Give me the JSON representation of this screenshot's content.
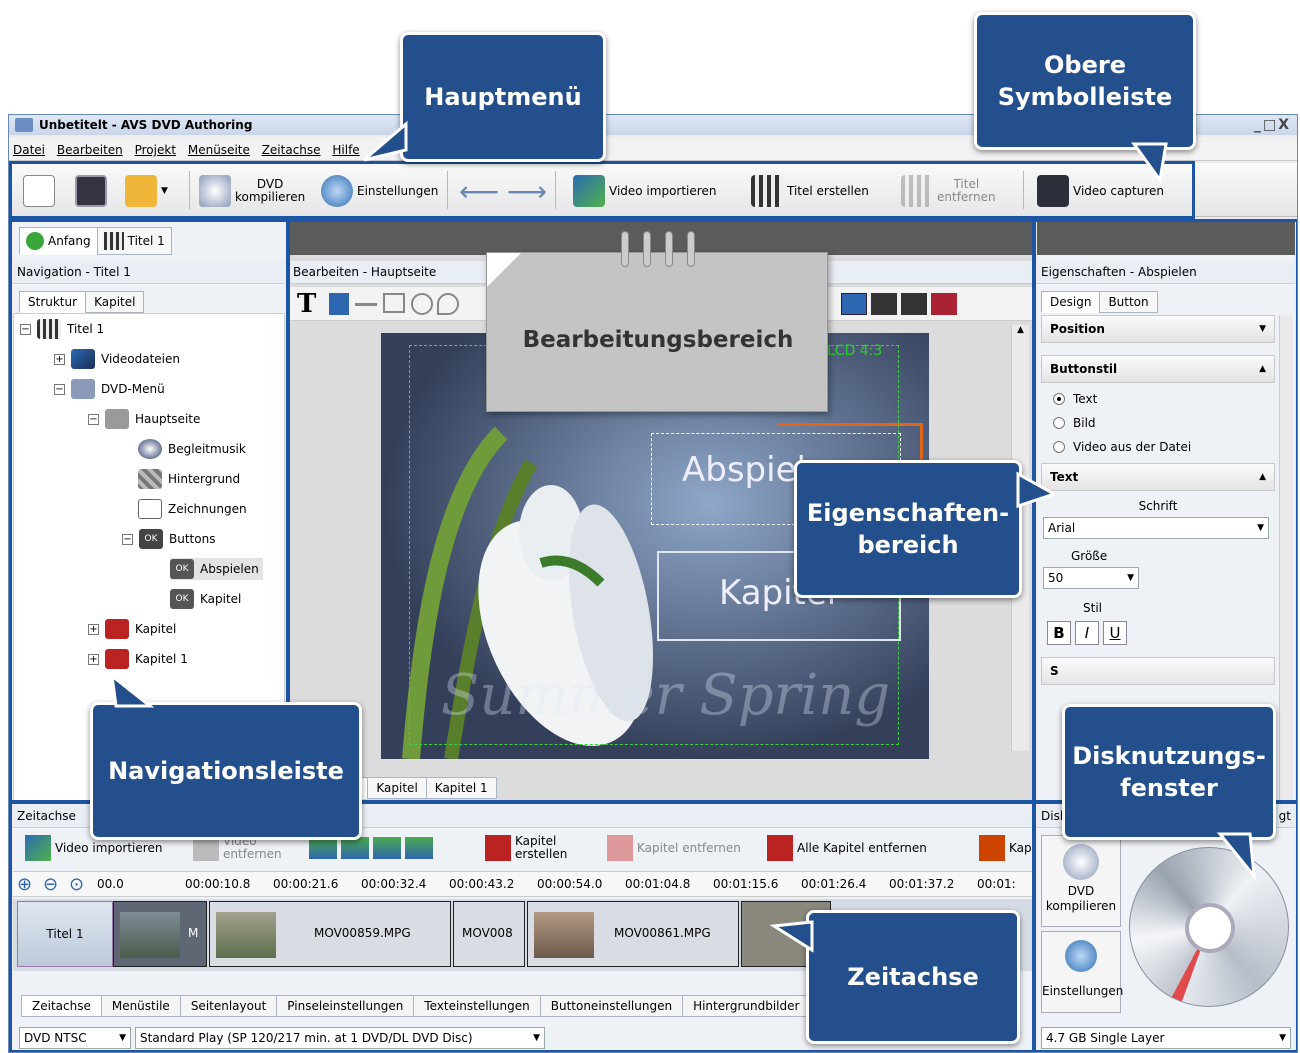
{
  "window": {
    "title": "Unbetitelt - AVS DVD Authoring",
    "controls": "_□X"
  },
  "menu": [
    "Datei",
    "Bearbeiten",
    "Projekt",
    "Menüseite",
    "Zeitachse",
    "Hilfe"
  ],
  "toolbar": {
    "dvd_compile": "DVD\nkompilieren",
    "settings": "Einstellungen",
    "import_video": "Video importieren",
    "create_title": "Titel erstellen",
    "remove_title": "Titel\nentfernen",
    "capture_video": "Video capturen"
  },
  "left": {
    "tabs": [
      "Anfang",
      "Titel 1"
    ],
    "header": "Navigation - Titel 1",
    "subtabs": [
      "Struktur",
      "Kapitel"
    ],
    "tree": [
      "Titel 1",
      "Videodateien",
      "DVD-Menü",
      "Hauptseite",
      "Begleitmusik",
      "Hintergrund",
      "Zeichnungen",
      "Buttons",
      "Abspielen",
      "Kapitel",
      "Kapitel",
      "Kapitel 1"
    ]
  },
  "editor": {
    "header": "Bearbeiten - Hauptseite",
    "lcd": "LCD 4:3",
    "btn_play": "Abspielen",
    "btn_chapter": "Kapitel",
    "bottom_tabs": [
      "e",
      "Kapitel",
      "Kapitel 1"
    ],
    "watermark": "Summer Spring"
  },
  "props": {
    "header": "Eigenschaften - Abspielen",
    "tabs": [
      "Design",
      "Button"
    ],
    "position": "Position",
    "buttonstil": "Buttonstil",
    "radios": [
      "Text",
      "Bild",
      "Video aus der Datei"
    ],
    "text": "Text",
    "schrift": "Schrift",
    "font": "Arial",
    "groesse": "Größe",
    "size": "50",
    "stil": "Stil",
    "b": "B",
    "i": "I",
    "u": "U",
    "s": "S"
  },
  "timeline": {
    "header": "Zeitachse",
    "import": "Video importieren",
    "remove_video": "Video\nentfernen",
    "chapter_create": "Kapitel\nerstellen",
    "chapter_remove": "Kapitel entfernen",
    "all_chapters_remove": "Alle Kapitel entfernen",
    "kap": "Kap",
    "ruler": [
      "00.0",
      "00:00:10.8",
      "00:00:21.6",
      "00:00:32.4",
      "00:00:43.2",
      "00:00:54.0",
      "00:01:04.8",
      "00:01:15.6",
      "00:01:26.4",
      "00:01:37.2",
      "00:01:"
    ],
    "track": "Titel 1",
    "clips": [
      "M",
      "MOV00859.MPG",
      "MOV008",
      "MOV00861.MPG"
    ],
    "bottom_tabs": [
      "Zeitachse",
      "Menüstile",
      "Seitenlayout",
      "Pinseleinstellungen",
      "Texteinstellungen",
      "Buttoneinstellungen",
      "Hintergrundbilder"
    ],
    "format": "DVD NTSC",
    "quality": "Standard Play (SP 120/217 min. at 1 DVD/DL DVD Disc)"
  },
  "disk": {
    "header": "Disk",
    "header_r": "gt",
    "compile": "DVD\nkompilieren",
    "settings": "Einstellungen",
    "layer": "4.7 GB Single Layer"
  },
  "callouts": {
    "hauptmenu": "Hauptmenü",
    "obere": "Obere\nSymbolleiste",
    "bearb": "Bearbeitungsbereich",
    "eigen": "Eigenschaften-\nbereich",
    "nav": "Navigationsleiste",
    "disk": "Disknutzungs-\nfenster",
    "zeit": "Zeitachse"
  },
  "colors": {
    "callout": "#23508c",
    "accent_border": "#1d55a5"
  }
}
